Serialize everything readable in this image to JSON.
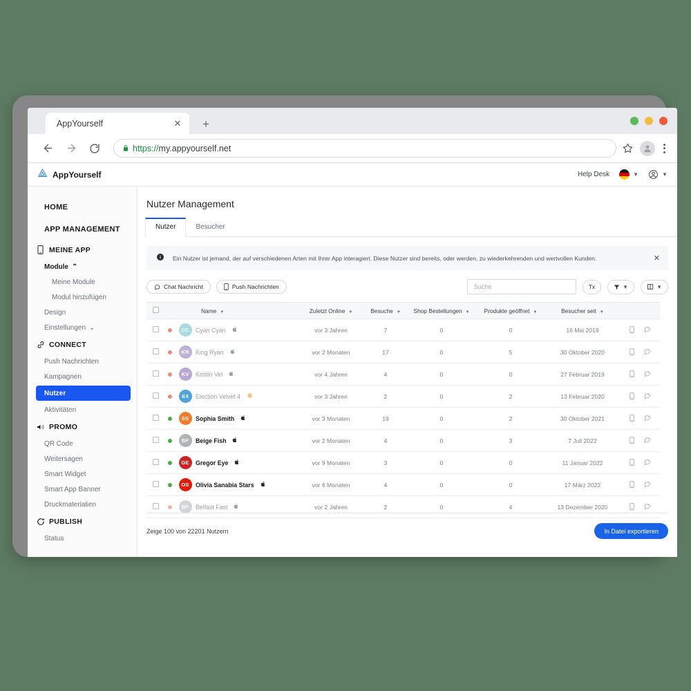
{
  "browser": {
    "tab_title": "AppYourself",
    "tab_close_icon": "close-icon",
    "new_tab_icon": "plus-icon",
    "back_icon": "arrow-left-icon",
    "forward_icon": "arrow-right-icon",
    "reload_icon": "reload-icon",
    "lock_icon": "lock-icon",
    "url_scheme": "https://",
    "url_host": "my.appyourself.net",
    "bookmark_icon": "star-icon",
    "profile_icon": "user-avatar-icon",
    "menu_icon": "three-dots-icon",
    "traffic_lights": [
      "#5cb85c",
      "#f5bb3e",
      "#ec5b3c"
    ]
  },
  "app_header": {
    "brand": "AppYourself",
    "logo_icon": "appyourself-logo-icon",
    "help_desk": "Help Desk",
    "flag_icon": "german-flag-icon",
    "account_icon": "account-circle-icon",
    "chevron_icon": "chevron-down-icon"
  },
  "sidebar": {
    "top_items": [
      {
        "label": "HOME"
      },
      {
        "label": "APP MANAGEMENT"
      }
    ],
    "sections": [
      {
        "label": "MEINE APP",
        "icon": "mobile-phone-icon",
        "items": [
          {
            "label": "Module",
            "style": "bold",
            "chevron": "⌃"
          },
          {
            "label": "Meine Module",
            "style": "deep"
          },
          {
            "label": "Modul hinzufügen",
            "style": "deep"
          },
          {
            "label": "Design",
            "style": "normal"
          },
          {
            "label": "Einstellungen",
            "style": "normal",
            "chevron": "⌄"
          }
        ]
      },
      {
        "label": "CONNECT",
        "icon": "link-icon",
        "items": [
          {
            "label": "Push Nachrichten",
            "style": "normal"
          },
          {
            "label": "Kampagnen",
            "style": "normal"
          },
          {
            "label": "Nutzer",
            "style": "active"
          },
          {
            "label": "Aktivitäten",
            "style": "normal"
          }
        ]
      },
      {
        "label": "PROMO",
        "icon": "megaphone-icon",
        "items": [
          {
            "label": "QR Code",
            "style": "normal"
          },
          {
            "label": "Weitersagen",
            "style": "normal"
          },
          {
            "label": "Smart Widget",
            "style": "normal"
          },
          {
            "label": "Smart App Banner",
            "style": "normal"
          },
          {
            "label": "Druckmaterialien",
            "style": "normal"
          }
        ]
      },
      {
        "label": "PUBLISH",
        "icon": "sync-icon",
        "items": [
          {
            "label": "Status",
            "style": "normal"
          }
        ]
      }
    ],
    "active_color": "#1a56f0"
  },
  "main": {
    "page_title": "Nutzer Management",
    "tabs": [
      {
        "label": "Nutzer",
        "active": true
      },
      {
        "label": "Besucher",
        "active": false
      }
    ],
    "info_banner": {
      "icon": "info-icon",
      "text": "Ein Nutzer ist jemand, der auf verschiedenen Arten mit Ihrer App interagiert. Diese Nutzer sind bereits, oder werden, zu wiederkehrenden und wertvollen Kunden.",
      "close_icon": "close-icon"
    },
    "toolbar": {
      "chat_button": "Chat Nachricht",
      "chat_icon": "chat-bubble-icon",
      "push_button": "Push Nachrichten",
      "push_icon": "mobile-phone-icon",
      "search_placeholder": "Suche",
      "search_value": "",
      "text_button": "Tx",
      "filter_icon": "funnel-icon",
      "columns_icon": "columns-icon",
      "chevron_icon": "chevron-down-icon"
    },
    "table": {
      "columns": [
        "Name",
        "Zuletzt Online",
        "Besuche",
        "Shop Bestellungen",
        "Produkte geöffnet",
        "Besucher seit"
      ],
      "sort_icon": "sort-arrow-icon",
      "rows": [
        {
          "name": "Cyan Cyan",
          "initials": "CC",
          "avatar_color": "#a8dbdf",
          "status_color": "#f08a7a",
          "os": "apple",
          "last_online": "vor 3 Jahren",
          "visits": "7",
          "shop_orders": "0",
          "products_opened": "0",
          "visitor_since": "16 Mai 2019",
          "state": "faded"
        },
        {
          "name": "King Ryan",
          "initials": "KR",
          "avatar_color": "#bfb0d9",
          "status_color": "#f08a7a",
          "os": "apple",
          "last_online": "vor 2 Monaten",
          "visits": "17",
          "shop_orders": "0",
          "products_opened": "5",
          "visitor_since": "30 Oktober 2020",
          "state": "faded"
        },
        {
          "name": "Kristin Vel",
          "initials": "KV",
          "avatar_color": "#b9a7d4",
          "status_color": "#f08a7a",
          "os": "apple",
          "last_online": "vor 4 Jahren",
          "visits": "4",
          "shop_orders": "0",
          "products_opened": "0",
          "visitor_since": "27 Februar 2019",
          "state": "faded"
        },
        {
          "name": "Election Velvet 4",
          "initials": "E4",
          "avatar_color": "#4fa3dd",
          "status_color": "#f08a7a",
          "os": "android",
          "last_online": "vor 3 Jahren",
          "visits": "2",
          "shop_orders": "0",
          "products_opened": "2",
          "visitor_since": "13 Februar 2020",
          "state": "faded"
        },
        {
          "name": "Sophia Smith",
          "initials": "SS",
          "avatar_color": "#f07d2e",
          "status_color": "#4aab4a",
          "os": "apple",
          "last_online": "vor 3 Monaten",
          "visits": "19",
          "shop_orders": "0",
          "products_opened": "2",
          "visitor_since": "30 Oktober 2021",
          "state": "active"
        },
        {
          "name": "Beige Fish",
          "initials": "BF",
          "avatar_color": "#b0b4b8",
          "status_color": "#4aab4a",
          "os": "apple",
          "last_online": "vor 2 Monaten",
          "visits": "4",
          "shop_orders": "0",
          "products_opened": "3",
          "visitor_since": "7 Juli 2022",
          "state": "active"
        },
        {
          "name": "Gregor Eye",
          "initials": "GE",
          "avatar_color": "#cf2222",
          "status_color": "#4aab4a",
          "os": "apple",
          "last_online": "vor 9 Monaten",
          "visits": "3",
          "shop_orders": "0",
          "products_opened": "0",
          "visitor_since": "11 Januar 2022",
          "state": "active"
        },
        {
          "name": "Olivia Sanabia Stars",
          "initials": "OS",
          "avatar_color": "#e01b0c",
          "status_color": "#4aab4a",
          "os": "apple",
          "last_online": "vor 6 Monaten",
          "visits": "4",
          "shop_orders": "0",
          "products_opened": "0",
          "visitor_since": "17 März 2022",
          "state": "active"
        },
        {
          "name": "Belfast Fast",
          "initials": "BF",
          "avatar_color": "#d2d5d8",
          "status_color": "#f3b4a8",
          "os": "apple",
          "last_online": "vor 2 Jahren",
          "visits": "2",
          "shop_orders": "0",
          "products_opened": "4",
          "visitor_since": "13 Dezember 2020",
          "state": "faded"
        }
      ],
      "row_action_icons": [
        "mobile-phone-icon",
        "chat-bubble-icon"
      ]
    },
    "footer": {
      "result_count": "Zeige 100 von 22201 Nutzern",
      "export_button": "In Datei exportieren",
      "export_color": "#1a62e8"
    }
  }
}
